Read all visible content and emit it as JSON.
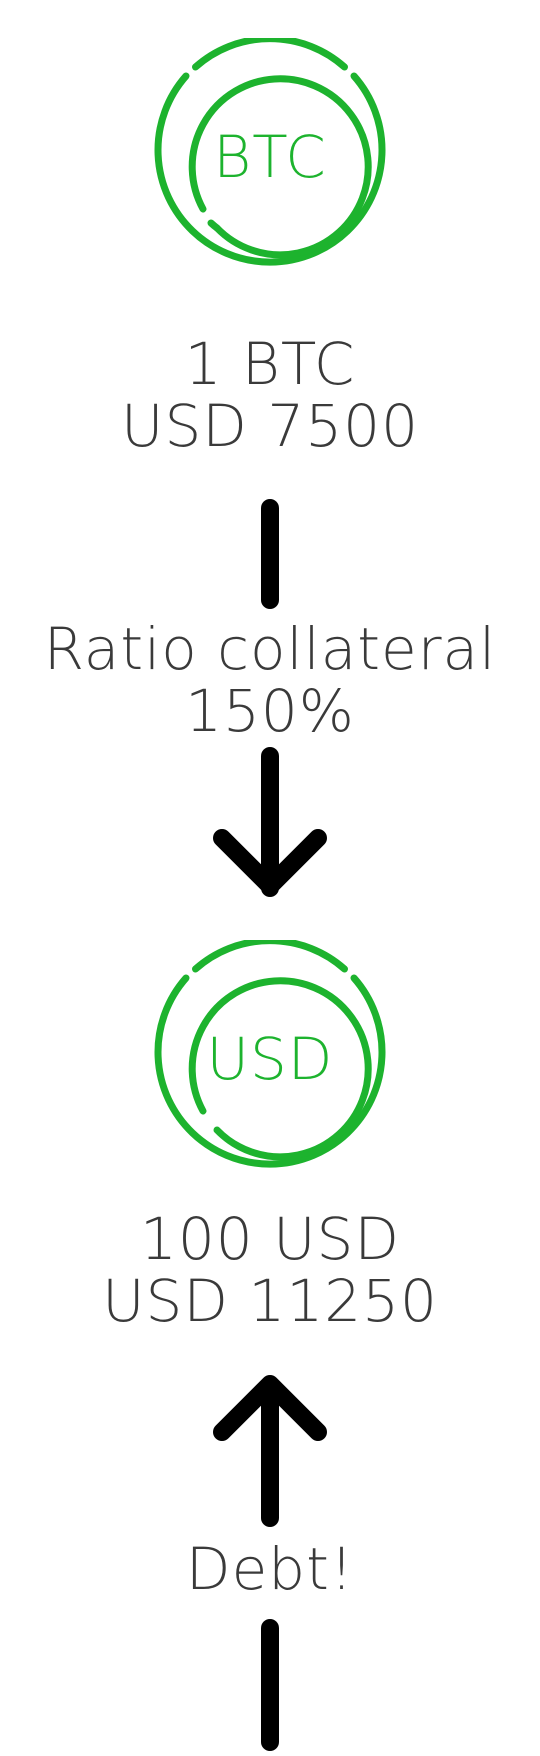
{
  "btc_coin": {
    "symbol": "BTC",
    "color": "#1db32e",
    "amount_label": "1 BTC",
    "value_label": "USD 7500"
  },
  "ratio": {
    "label": "Ratio collateral",
    "value": "150%"
  },
  "usd_coin": {
    "symbol": "USD",
    "color": "#1db32e",
    "amount_label": "100 USD",
    "value_label": "USD 11250"
  },
  "debt": {
    "label": "Debt!"
  },
  "colors": {
    "accent": "#1db32e",
    "text": "#3a3a3a",
    "connector": "#000000"
  },
  "icons": [
    "btc-coin-icon",
    "usd-coin-icon",
    "arrow-down-icon",
    "arrow-up-icon"
  ]
}
